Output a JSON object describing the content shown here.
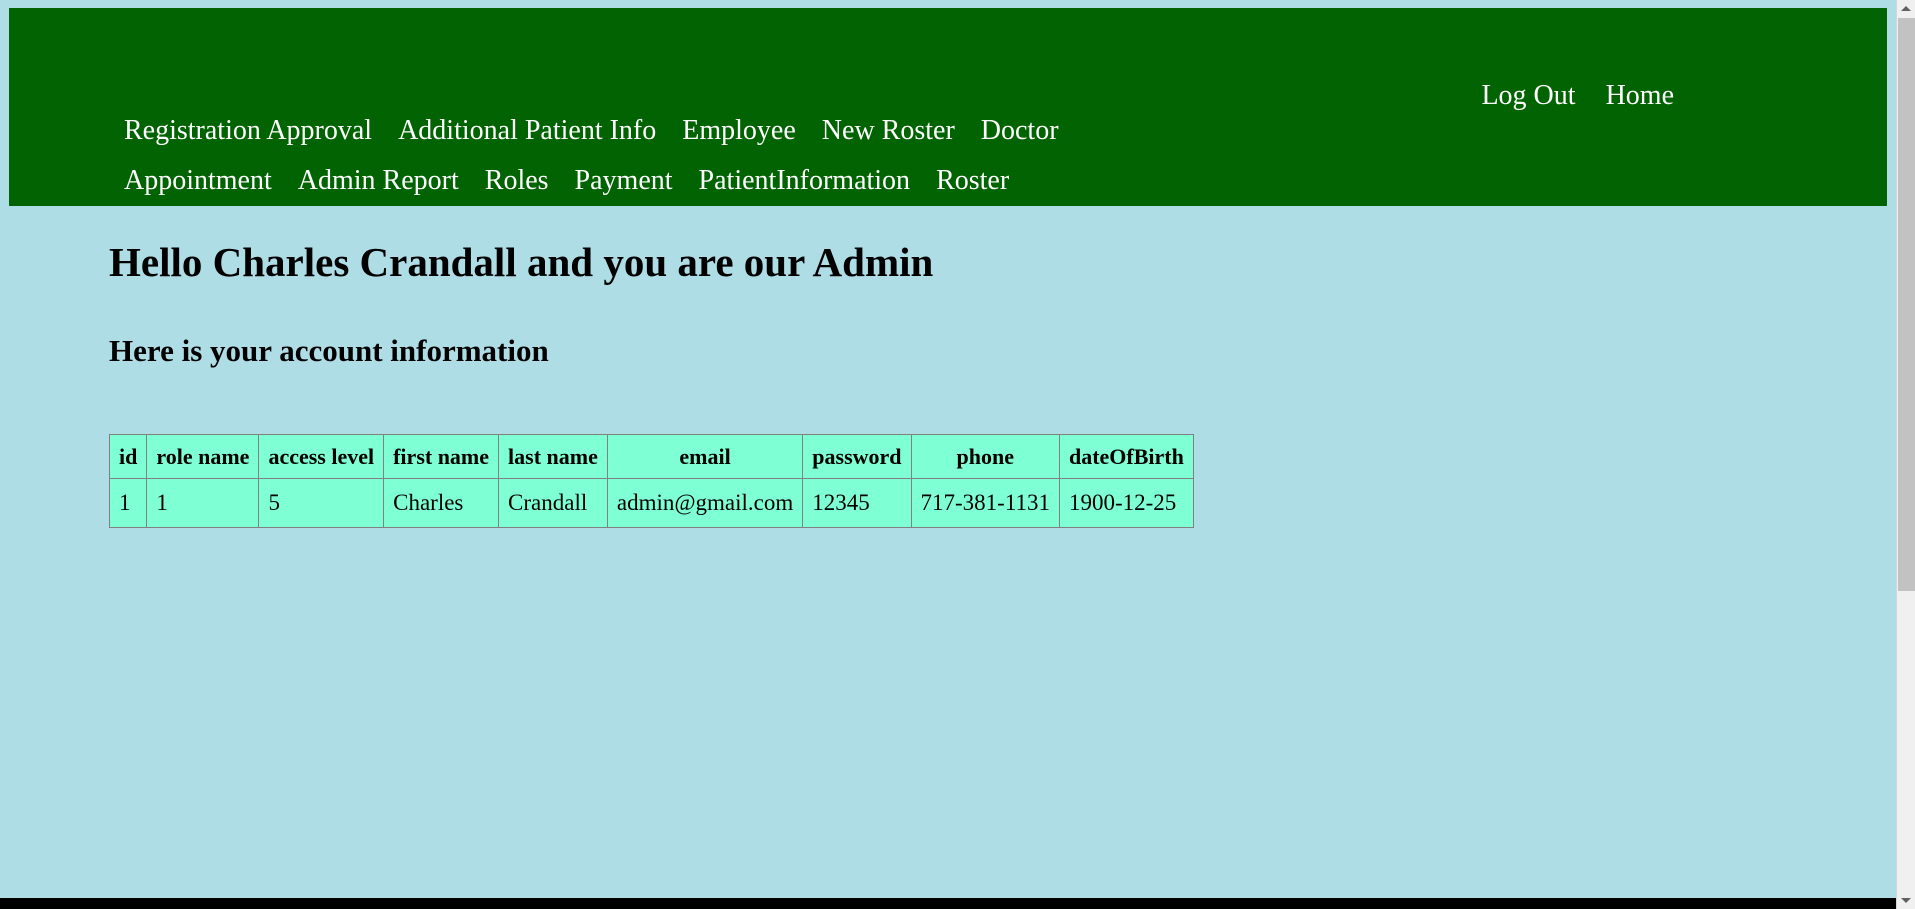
{
  "theme": {
    "header_bg": "#026302",
    "page_bg": "#aedde6",
    "table_bg": "#7fffd4",
    "table_border": "#808080",
    "nav_link_color": "#ffffff",
    "text_color": "#000000"
  },
  "header": {
    "top_links": [
      {
        "label": "Log Out",
        "name": "nav-link-log-out"
      },
      {
        "label": "Home",
        "name": "nav-link-home"
      }
    ],
    "nav_rows": [
      [
        {
          "label": "Registration Approval",
          "name": "nav-link-registration-approval"
        },
        {
          "label": "Additional Patient Info",
          "name": "nav-link-additional-patient-info"
        },
        {
          "label": "Employee",
          "name": "nav-link-employee"
        },
        {
          "label": "New Roster",
          "name": "nav-link-new-roster"
        },
        {
          "label": "Doctor",
          "name": "nav-link-doctor"
        }
      ],
      [
        {
          "label": "Appointment",
          "name": "nav-link-appointment"
        },
        {
          "label": "Admin Report",
          "name": "nav-link-admin-report"
        },
        {
          "label": "Roles",
          "name": "nav-link-roles"
        },
        {
          "label": "Payment",
          "name": "nav-link-payment"
        },
        {
          "label": "PatientInformation",
          "name": "nav-link-patient-information"
        },
        {
          "label": "Roster",
          "name": "nav-link-roster"
        }
      ]
    ]
  },
  "main": {
    "title": "Hello Charles Crandall and you are our Admin",
    "subtitle": "Here is your account information",
    "account_table": {
      "columns": [
        "id",
        "role name",
        "access level",
        "first name",
        "last name",
        "email",
        "password",
        "phone",
        "dateOfBirth"
      ],
      "rows": [
        {
          "id": "1",
          "role_name": "1",
          "access_level": "5",
          "first_name": "Charles",
          "last_name": "Crandall",
          "email": "admin@gmail.com",
          "password": "12345",
          "phone": "717-381-1131",
          "date_of_birth": "1900-12-25"
        }
      ]
    }
  }
}
